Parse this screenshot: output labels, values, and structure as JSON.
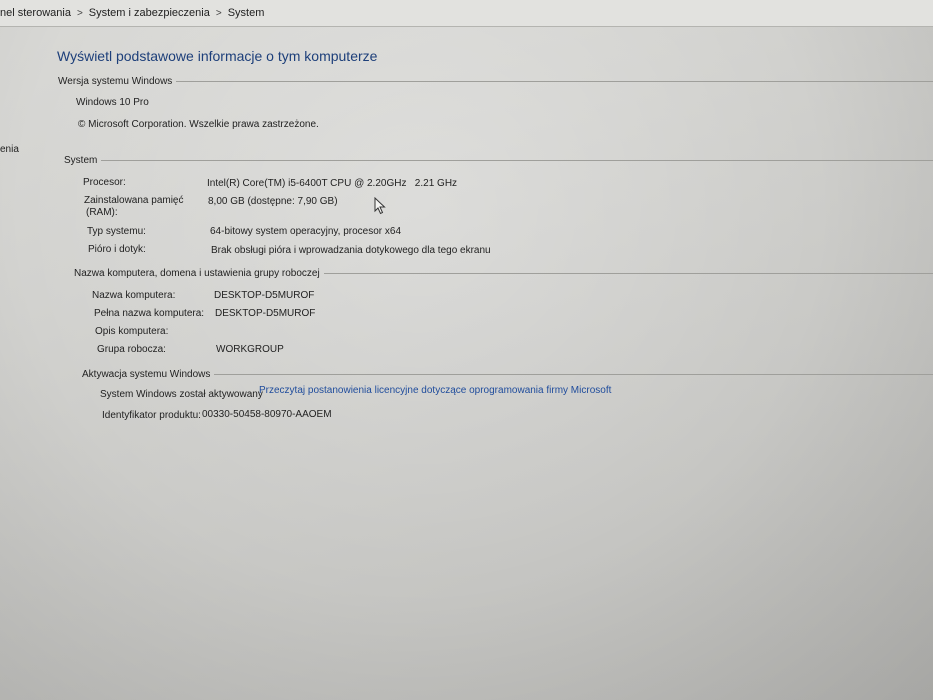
{
  "breadcrumb": {
    "items": [
      "nel sterowania",
      "System i zabezpieczenia",
      "System"
    ],
    "separator": ">"
  },
  "page": {
    "title": "Wyświetl podstawowe informacje o tym komputerze",
    "side_fragment": "enia"
  },
  "windows_edition": {
    "header": "Wersja systemu Windows",
    "edition": "Windows 10 Pro",
    "copyright": "© Microsoft Corporation. Wszelkie prawa zastrzeżone."
  },
  "system": {
    "header": "System",
    "processor_label": "Procesor:",
    "processor_value": "Intel(R) Core(TM) i5-6400T CPU @ 2.20GHz   2.21 GHz",
    "memory_label_1": "Zainstalowana pamięć",
    "memory_label_2": "(RAM):",
    "memory_value": "8,00 GB (dostępne: 7,90 GB)",
    "type_label": "Typ systemu:",
    "type_value": "64-bitowy system operacyjny, procesor x64",
    "pen_label": "Pióro i dotyk:",
    "pen_value": "Brak obsługi pióra i wprowadzania dotykowego dla tego ekranu"
  },
  "computer_name": {
    "header": "Nazwa komputera, domena i ustawienia grupy roboczej",
    "name_label": "Nazwa komputera:",
    "name_value": "DESKTOP-D5MUROF",
    "full_label": "Pełna nazwa komputera:",
    "full_value": "DESKTOP-D5MUROF",
    "desc_label": "Opis komputera:",
    "desc_value": "",
    "group_label": "Grupa robocza:",
    "group_value": "WORKGROUP"
  },
  "activation": {
    "header": "Aktywacja systemu Windows",
    "status": "System Windows został aktywowany",
    "license_link": "Przeczytaj postanowienia licencyjne dotyczące oprogramowania firmy Microsoft",
    "product_id_label": "Identyfikator produktu:",
    "product_id_value": "00330-50458-80970-AAOEM"
  },
  "colors": {
    "title": "#1d3f7a",
    "link": "#1f4c9c",
    "background": "#d2d2cf"
  }
}
